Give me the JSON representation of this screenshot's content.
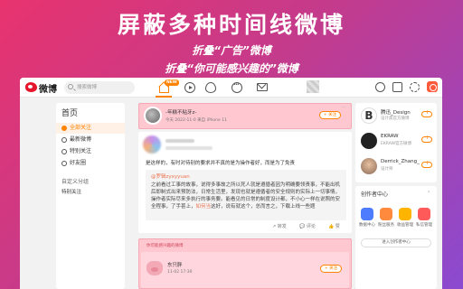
{
  "banner": {
    "title": "屏蔽多种时间线微博",
    "line1": "折叠“广告”微博",
    "line2": "折叠“你可能感兴趣的”微博"
  },
  "topbar": {
    "logo_text": "微博",
    "search_placeholder": "搜索微博",
    "home_badge": "NEW",
    "nav_icons": [
      "home-icon",
      "video-icon",
      "hot-icon",
      "message-icon",
      "mail-icon"
    ],
    "right_icons": [
      "create-icon",
      "compose-icon",
      "settings-icon",
      "weibo-app-icon"
    ]
  },
  "leftnav": {
    "heading": "首页",
    "items": [
      {
        "label": "全部关注",
        "active": true
      },
      {
        "label": "最新微博",
        "active": false
      },
      {
        "label": "特别关注",
        "active": false
      },
      {
        "label": "好友圈",
        "active": false
      }
    ],
    "group_heading": "自定义分组",
    "group_items": [
      "特别关注"
    ]
  },
  "feed": {
    "card1": {
      "user": "-年糕不粘牙z-",
      "meta": "今天 2022-11-0 来自 iPhone 11",
      "follow": "+ 关注",
      "more": "···"
    },
    "card2": {
      "line1": "是这样的，有时对待别的要求并不真的是为操作者好，而是为了免责",
      "repost_user": "@罗辑zyxyyuan",
      "repost_text_pre": "之前看过工事的故事，说得多事故之所以死人就是遵循者因为明确要领责事，不能出机后即制式出来预防法，日常生活里，发现也就是遵循者的安全规则的实际上一切事情，操作者实际尽来多执行的事务要。能看见的日常的制度设计都，不小心一样在说照的安全程事，了手甚上，",
      "repost_text_hl": "如何当",
      "repost_text_post": "这好，说有就这个，总而言之，下载上线一些题",
      "actions": {
        "share": "↗ 转发",
        "comment": "💬 评论",
        "like": "👍 赞"
      }
    },
    "card3": {
      "hint": "你可能感兴趣的微博",
      "user": "东只胖",
      "meta": "11-02 17:30",
      "follow": "+ 关注",
      "more": "···"
    }
  },
  "rightcol": {
    "suggestions": [
      {
        "name": "腾迅_Design",
        "desc": "设计类官方微博",
        "color": "#222222"
      },
      {
        "name": "EKRAW",
        "desc": "EKRAW官方微博",
        "color": "#3a3a3a"
      },
      {
        "name": "Derrick_Zhang_",
        "desc": "设计师",
        "color": "#8a6a55"
      }
    ],
    "creator_title": "创作者中心",
    "chevron": "›",
    "tools": [
      {
        "label": "数据中心",
        "color": "#4d7cfe"
      },
      {
        "label": "粉丝服务",
        "color": "#ff8a3d"
      },
      {
        "label": "收益管理",
        "color": "#ffb400"
      },
      {
        "label": "私信管理",
        "color": "#ff5a5a"
      }
    ],
    "more_button": "进入创作者中心"
  }
}
